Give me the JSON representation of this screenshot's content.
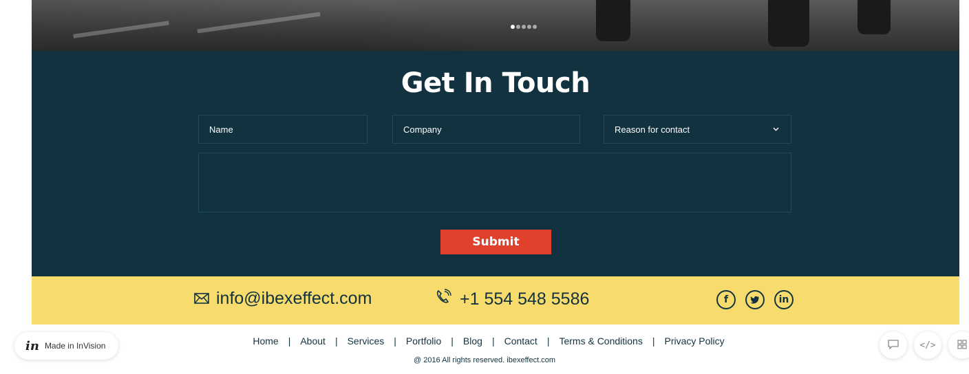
{
  "hero": {
    "slide_count": 5,
    "active_slide": 1
  },
  "contact": {
    "title": "Get In Touch",
    "name_placeholder": "Name",
    "company_placeholder": "Company",
    "reason_label": "Reason for contact",
    "submit_label": "Submit"
  },
  "info": {
    "email": "info@ibexeffect.com",
    "phone": "+1 554 548 5586",
    "social": [
      "f",
      "t",
      "in"
    ]
  },
  "footer": {
    "links": [
      "Home",
      "About",
      "Services",
      "Portfolio",
      "Blog",
      "Contact",
      "Terms & Conditions",
      "Privacy Policy"
    ],
    "separator": "|",
    "copyright": "@ 2016 All rights reserved. ibexeffect.com"
  },
  "invision": {
    "logo": "in",
    "label": "Made in InVision",
    "code_icon": "</>"
  },
  "colors": {
    "navy": "#12323f",
    "yellow": "#f7db6d",
    "red": "#e0412c"
  }
}
